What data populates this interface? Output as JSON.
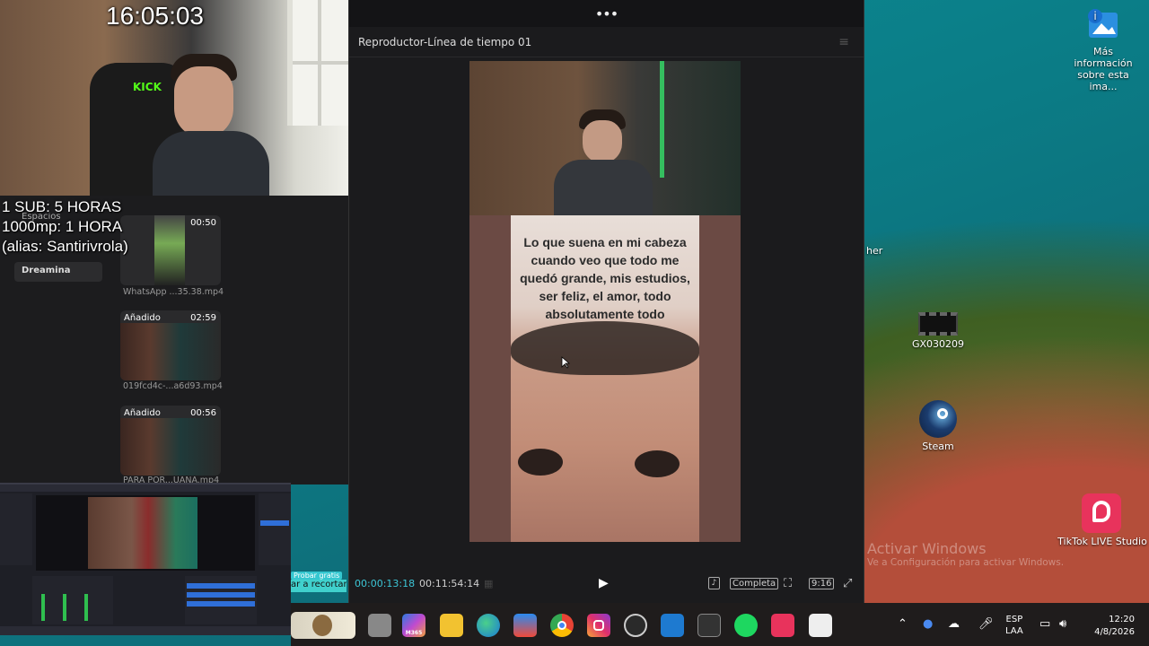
{
  "webcam": {
    "clock": "16:05:03",
    "stream_lines": [
      "1 SUB: 5 HORAS",
      "1000mp: 1 HORA",
      "(alias: Santirivrola)"
    ],
    "chair_logo": "KICK"
  },
  "editor": {
    "sidebar": [
      {
        "label": "Espacios"
      },
      {
        "label": "Dreamina"
      }
    ],
    "media": [
      {
        "badge": "",
        "duration": "00:50",
        "name": "WhatsApp ...35.38.mp4"
      },
      {
        "badge": "Añadido",
        "duration": "02:59",
        "name": "019fcd4c-...a6d93.mp4"
      },
      {
        "badge": "Añadido",
        "duration": "00:56",
        "name": "PARA POR...UANA.mp4"
      }
    ],
    "promo_badge": "Probar gratis",
    "promo_text": "ar a recortar"
  },
  "player": {
    "title": "Reproductor-Línea de tiempo 01",
    "overlay_text": "Lo que suena en mi cabeza cuando veo que todo me quedó grande, mis estudios, ser feliz, el amor, todo absolutamente todo",
    "timecode_current": "00:00:13:18",
    "timecode_total": "00:11:54:14",
    "quality_label": "Completa",
    "aspect_label": "9:16"
  },
  "desktop": {
    "icons": [
      {
        "label": "Más información sobre esta ima..."
      },
      {
        "label": "GX030209"
      },
      {
        "label": "Steam"
      },
      {
        "label": "TikTok LIVE Studio"
      }
    ],
    "partial_label": "her",
    "watermark_title": "Activar Windows",
    "watermark_sub": "Ve a Configuración para activar Windows."
  },
  "taskbar": {
    "apps": [
      {
        "name": "owl-app-icon",
        "label": ""
      },
      {
        "name": "file-viewer-icon",
        "label": ""
      },
      {
        "name": "m365-icon",
        "label": "M365"
      },
      {
        "name": "file-explorer-icon",
        "label": ""
      },
      {
        "name": "edge-icon",
        "label": ""
      },
      {
        "name": "store-icon",
        "label": ""
      },
      {
        "name": "chrome-icon",
        "label": ""
      },
      {
        "name": "instagram-icon",
        "label": ""
      },
      {
        "name": "obs-icon",
        "label": ""
      },
      {
        "name": "vscode-icon",
        "label": ""
      },
      {
        "name": "camera-app-icon",
        "label": ""
      },
      {
        "name": "spotify-icon",
        "label": ""
      },
      {
        "name": "tiktok-icon",
        "label": ""
      },
      {
        "name": "capcut-icon",
        "label": ""
      }
    ],
    "lang_top": "ESP",
    "lang_bottom": "LAA",
    "time": "12:20",
    "date": "4/8/2026"
  },
  "colors": {
    "accent_cyan": "#3cc6d6",
    "panel_bg": "#1b1b1d",
    "taskbar_bg": "#1f1c1c"
  }
}
